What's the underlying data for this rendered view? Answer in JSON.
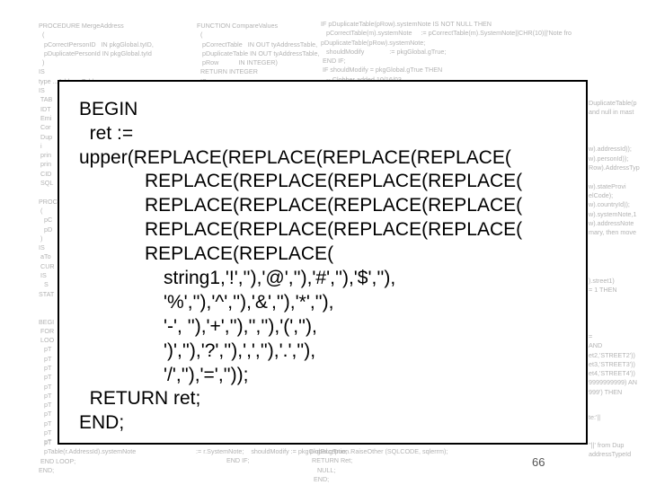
{
  "background_code": {
    "col1": [
      "PROCEDURE MergeAddress",
      "  (",
      "   pCorrectPersonID   IN pkgGlobal.tyID,",
      "   pDuplicatePersonId IN pkgGlobal.tyId",
      "  )",
      "IS",
      "type ...AddressTable",
      "IS",
      " TAB",
      " IDT",
      " Emi",
      " Cor",
      " Dup",
      " i",
      " prin",
      " prin",
      " CID",
      " SQL",
      "",
      "PROC",
      " (",
      "   pC",
      "   pD",
      " )",
      "IS",
      " aTo",
      " CUR",
      " IS",
      "   S",
      "STAT",
      "",
      "",
      "BEGI",
      " FOR",
      " LOO",
      "   pT",
      "   pT",
      "   pT",
      "   pT",
      "   pT",
      "   pT",
      "   pT",
      "   pT",
      "   pT",
      "   pT",
      "   pT"
    ],
    "col2": [
      "FUNCTION CompareValues",
      "  (",
      "   pCorrectTable   IN OUT tyAddressTable,",
      "   pDuplicateTable IN OUT tyAddressTable,",
      "   pRow           IN INTEGER)",
      "  RETURN INTEGER",
      "  IS"
    ],
    "col3": [
      "IF pDuplicateTable(pRow).systemNote IS NOT NULL THEN",
      "   pCorrectTable(m).systemNote     := pCorrectTable(m).SystemNote||CHR(10)||'Note fro",
      "pDuplicateTable(pRow).systemNote;",
      "   shouldModify              := pkgGlobal.gTrue;",
      " END IF;",
      " IF shouldModify = pkgGlobal.gTrue THEN",
      "   -- Clobber added 10/16/03"
    ],
    "col4": [
      "DuplicateTable(p",
      "and null in mast",
      "",
      "",
      "",
      "w).addressId));",
      "w).personId));",
      "Row).AddressTyp",
      "",
      "w).stateProvi",
      "elCode);",
      "w).countryId));",
      "w).systemNote,1",
      "w).addressNote",
      "mary, then move"
    ],
    "col5": [
      ").street1)",
      "= 1 THEN"
    ],
    "col6": [
      "=",
      "AND",
      "et2,'STREET2'))",
      "et3,'STREET3'))",
      "et4,'STREET4'))",
      "9999999999) AN",
      "999') THEN"
    ],
    "col7": [
      "te:'||",
      "",
      "",
      "''||' from Dup",
      "addressTypeId"
    ],
    "col8": [
      "   pT",
      "   pTable(r.AddressId).systemNote",
      " END LOOP;",
      "END;"
    ],
    "col9": [
      ":= r.SystemNote;    shouldModify := pkgGlobal.gTrue;",
      "                 END IF;"
    ],
    "col10": [
      "pkgException.RaiseOther (SQLCODE, sqlerrm);",
      " RETURN Ret;",
      "    NULL;",
      "  END;"
    ]
  },
  "code_block": {
    "lines": [
      "BEGIN",
      "  ret :=",
      "upper(REPLACE(REPLACE(REPLACE(REPLACE(",
      "REPLACE(REPLACE(REPLACE(REPLACE(",
      "REPLACE(REPLACE(REPLACE(REPLACE(",
      "REPLACE(REPLACE(REPLACE(REPLACE(",
      "REPLACE(REPLACE(",
      "string1,'!',''),'@',''),'#',''),'$',''),",
      "'%',''),'^',''),'&',''),'*',''),",
      "'-', ''),'+',''),'',''),'(',''),",
      "')',''),'?',''),',',''),'.',''),",
      "'/',''),'=',''));",
      "  RETURN ret;",
      "END;"
    ]
  },
  "page_number": "66"
}
